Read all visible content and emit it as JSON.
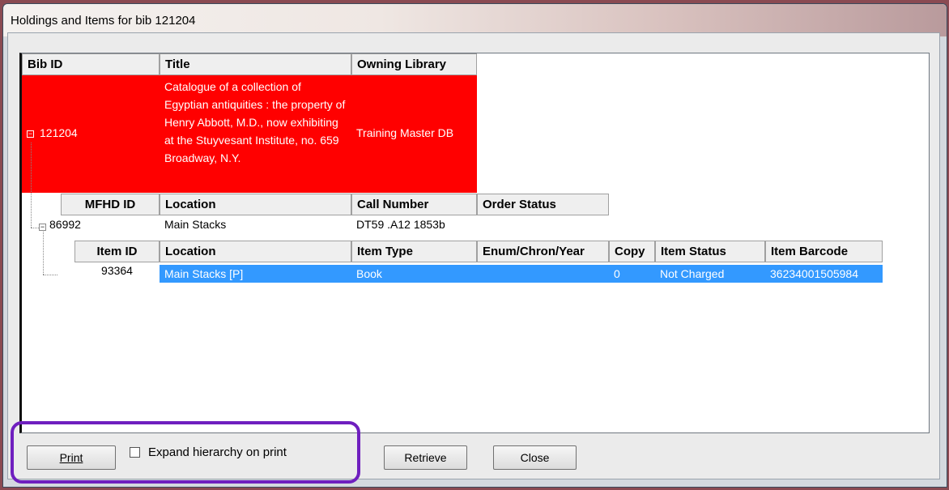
{
  "window": {
    "title": "Holdings and Items for bib 121204"
  },
  "bib": {
    "headers": {
      "id": "Bib ID",
      "title": "Title",
      "library": "Owning Library"
    },
    "row": {
      "id": "121204",
      "title": "Catalogue of a collection of Egyptian antiquities : the property of Henry Abbott, M.D., now exhibiting at the Stuyvesant Institute, no. 659 Broadway, N.Y.",
      "library": "Training Master DB"
    }
  },
  "mfhd": {
    "headers": {
      "id": "MFHD ID",
      "location": "Location",
      "call": "Call Number",
      "order": "Order Status"
    },
    "row": {
      "id": "86992",
      "location": "Main Stacks",
      "call": "DT59 .A12 1853b",
      "order": ""
    }
  },
  "items": {
    "headers": {
      "id": "Item ID",
      "location": "Location",
      "type": "Item Type",
      "enum": "Enum/Chron/Year",
      "copy": "Copy",
      "status": "Item Status",
      "barcode": "Item Barcode"
    },
    "row": {
      "id": "93364",
      "location": "Main Stacks [P]",
      "type": "Book",
      "enum": "",
      "copy": "0",
      "status": "Not Charged",
      "barcode": "36234001505984"
    }
  },
  "footer": {
    "print_label": "Print",
    "expand_label": "Expand hierarchy on print",
    "expand_checked": false,
    "retrieve_label": "Retrieve",
    "close_label": "Close"
  },
  "colors": {
    "selected_bib": "#ff0000",
    "selected_item": "#3399ff",
    "highlight": "#6f1fbf"
  }
}
